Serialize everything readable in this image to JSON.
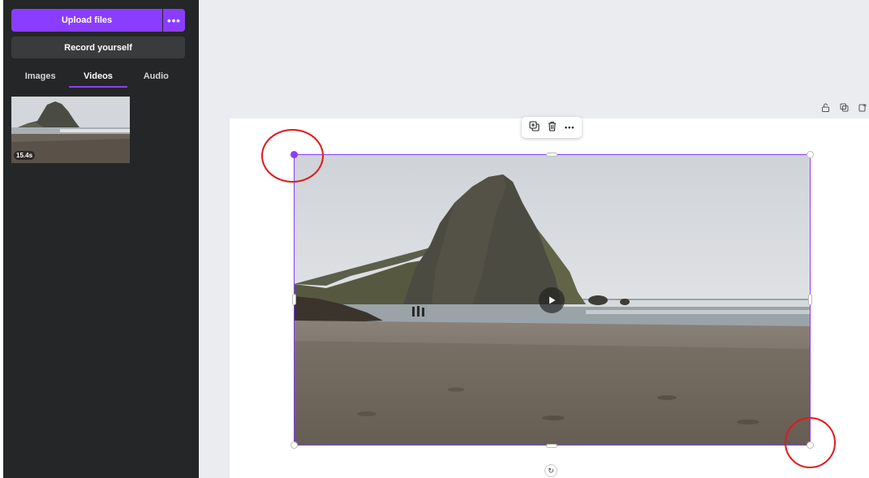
{
  "panel": {
    "upload_label": "Upload files",
    "upload_more_label": "•••",
    "record_label": "Record yourself",
    "tabs": [
      {
        "label": "Images",
        "active": false
      },
      {
        "label": "Videos",
        "active": true
      },
      {
        "label": "Audio",
        "active": false
      }
    ],
    "media": [
      {
        "type": "video",
        "duration": "15.4s"
      }
    ]
  },
  "toolbar": {
    "duplicate_icon": "duplicate-icon",
    "delete_icon": "trash-icon",
    "more_label": "•••"
  },
  "page_tools": [
    "lock-icon",
    "duplicate-page-icon",
    "add-page-icon"
  ],
  "colors": {
    "accent": "#8b3dff",
    "panel_bg": "#252627",
    "workspace_bg": "#ebecf0",
    "annotation": "#e0191b"
  }
}
